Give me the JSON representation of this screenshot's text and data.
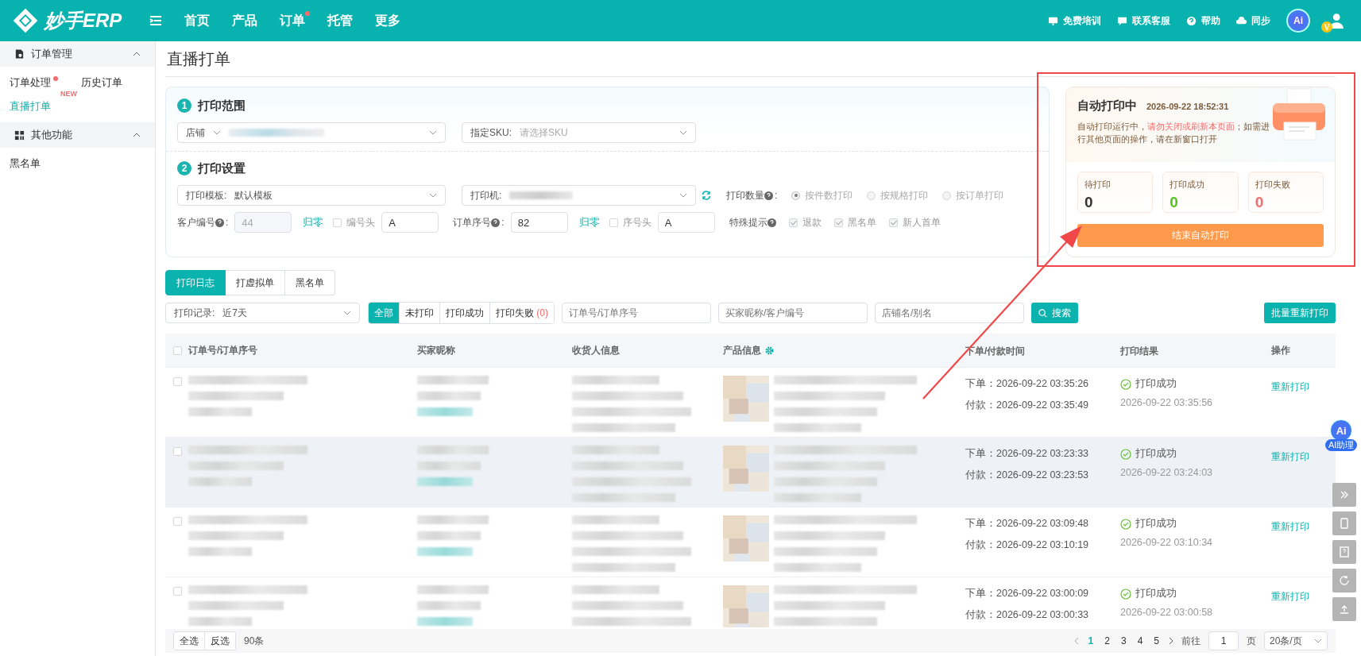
{
  "topbar": {
    "logo": "妙手ERP",
    "nav": [
      {
        "label": "首页",
        "dot": false
      },
      {
        "label": "产品",
        "dot": false
      },
      {
        "label": "订单",
        "dot": true
      },
      {
        "label": "托管",
        "dot": false
      },
      {
        "label": "更多",
        "dot": false
      }
    ],
    "links": [
      {
        "kind": "monitor",
        "label": "免费培训"
      },
      {
        "kind": "chat",
        "label": "联系客服"
      },
      {
        "kind": "help",
        "label": "帮助"
      },
      {
        "kind": "cloud",
        "label": "同步"
      }
    ],
    "ai_label": "Ai",
    "vip_badge": "V"
  },
  "sidebar": [
    {
      "title": "订单管理",
      "kind": "doc",
      "expanded": true,
      "items": [
        {
          "label": "订单处理",
          "selected": false,
          "dot": true
        },
        {
          "label": "历史订单",
          "selected": false,
          "dot": false
        },
        {
          "label": "直播打单",
          "selected": true,
          "dot": false,
          "badge": "NEW"
        }
      ]
    },
    {
      "title": "其他功能",
      "kind": "grid",
      "expanded": true,
      "items": [
        {
          "label": "黑名单",
          "selected": false,
          "dot": false
        }
      ]
    }
  ],
  "page_title": "直播打单",
  "scope": {
    "number": "1",
    "title": "打印范围",
    "shop_label": "店铺",
    "sku_label": "指定SKU:",
    "sku_placeholder": "请选择SKU"
  },
  "settings": {
    "number": "2",
    "title": "打印设置",
    "template_label": "打印模板:",
    "template_value": "默认模板",
    "printer_label": "打印机:",
    "qty_label": "打印数量",
    "qty_colon": ":",
    "qty_options": [
      {
        "label": "按件数打印",
        "selected": true
      },
      {
        "label": "按规格打印",
        "selected": false
      },
      {
        "label": "按订单打印",
        "selected": false
      }
    ],
    "customer": {
      "label": "客户编号",
      "colon": ":",
      "value": "44",
      "disabled": true,
      "reset": "归零",
      "check_label": "编号头",
      "checked": false,
      "prefix": "A"
    },
    "order": {
      "label": "订单序号",
      "colon": ":",
      "value": "82",
      "disabled": false,
      "reset": "归零",
      "check_label": "序号头",
      "checked": false,
      "prefix": "A"
    },
    "tips_label": "特殊提示",
    "tips": [
      {
        "label": "退款",
        "checked": true
      },
      {
        "label": "黑名单",
        "checked": true
      },
      {
        "label": "新人首单",
        "checked": true
      }
    ]
  },
  "auto_print": {
    "title": "自动打印中",
    "time": "2026-09-22 18:52:31",
    "message_before": "自动打印运行中，",
    "message_warning": "请勿关闭或刷新本页面",
    "message_after": "；如需进行其他页面的操作，请在新窗口打开",
    "stats": [
      {
        "label": "待打印",
        "value": "0",
        "color": "#333333"
      },
      {
        "label": "打印成功",
        "value": "0",
        "color": "#52c41a"
      },
      {
        "label": "打印失败",
        "value": "0",
        "color": "#f56c6c"
      }
    ],
    "stop_button": "结束自动打印"
  },
  "tabs": [
    {
      "label": "打印日志",
      "selected": true
    },
    {
      "label": "打虚拟单",
      "selected": false
    },
    {
      "label": "黑名单",
      "selected": false
    }
  ],
  "filter": {
    "range_label": "打印记录:",
    "range_value": "近7天",
    "statuses": [
      {
        "label": "全部",
        "selected": true
      },
      {
        "label": "未打印",
        "selected": false
      },
      {
        "label": "打印成功",
        "selected": false
      },
      {
        "label": "打印失败",
        "count": "(0)",
        "selected": false
      }
    ],
    "placeholders": [
      "订单号/订单序号",
      "买家昵称/客户编号",
      "店铺名/别名"
    ],
    "search_button": "搜索",
    "batch_button": "批量重新打印"
  },
  "table": {
    "all_checked": false,
    "columns": [
      "订单号/订单序号",
      "买家昵称",
      "收货人信息",
      "产品信息",
      "下单/付款时间",
      "打印结果",
      "操作"
    ],
    "rows": [
      {
        "checked": false,
        "hovered": false,
        "order_time": "下单：2026-09-22 03:35:26",
        "pay_time": "付款：2026-09-22 03:35:49",
        "result": "打印成功",
        "result_time": "2026-09-22 03:35:56",
        "action": "重新打印"
      },
      {
        "checked": false,
        "hovered": true,
        "order_time": "下单：2026-09-22 03:23:33",
        "pay_time": "付款：2026-09-22 03:23:53",
        "result": "打印成功",
        "result_time": "2026-09-22 03:24:03",
        "action": "重新打印"
      },
      {
        "checked": false,
        "hovered": false,
        "order_time": "下单：2026-09-22 03:09:48",
        "pay_time": "付款：2026-09-22 03:10:19",
        "result": "打印成功",
        "result_time": "2026-09-22 03:10:34",
        "action": "重新打印"
      },
      {
        "checked": false,
        "hovered": false,
        "order_time": "下单：2026-09-22 03:00:09",
        "pay_time": "付款：2026-09-22 03:00:33",
        "result": "打印成功",
        "result_time": "2026-09-22 03:00:58",
        "action": "重新打印"
      }
    ]
  },
  "footer": {
    "select_all": "全选",
    "invert": "反选",
    "total": "90条",
    "pages": [
      {
        "label": "1",
        "selected": true
      },
      {
        "label": "2",
        "selected": false
      },
      {
        "label": "3",
        "selected": false
      },
      {
        "label": "4",
        "selected": false
      },
      {
        "label": "5",
        "selected": false
      }
    ],
    "goto": "前往",
    "page_input": "1",
    "page_unit": "页",
    "page_size": "20条/页"
  },
  "ai_helper": {
    "icon": "Ai",
    "label": "AI助理"
  }
}
